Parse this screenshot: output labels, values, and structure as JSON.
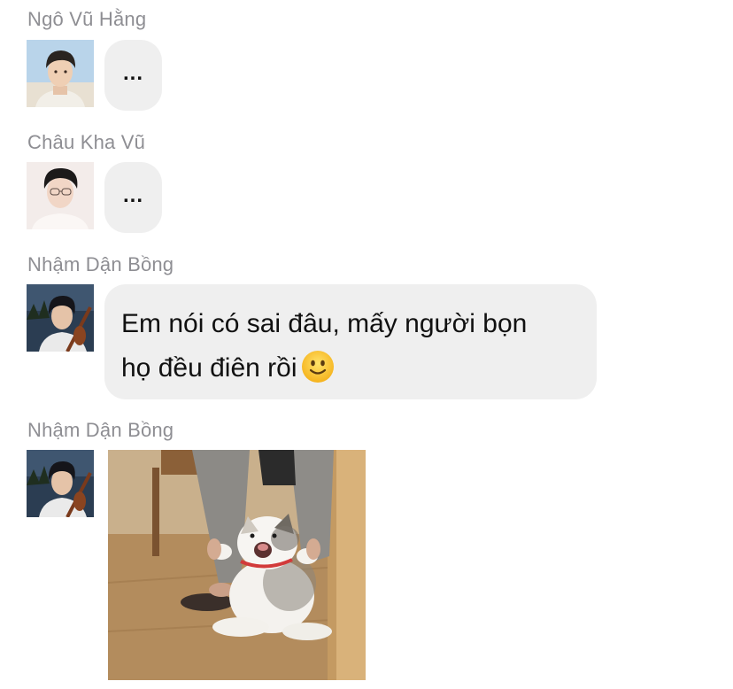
{
  "conversation": {
    "messages": [
      {
        "sender": "Ngô Vũ Hằng",
        "type": "typing",
        "text": "..."
      },
      {
        "sender": "Châu Kha Vũ",
        "type": "typing",
        "text": "..."
      },
      {
        "sender": "Nhậm Dận Bồng",
        "type": "text",
        "line1": "Em nói có sai đâu, mấy người bọn",
        "line2": "họ đều điên rồi",
        "emoji": "slightly-smiling-face-icon"
      },
      {
        "sender": "Nhậm Dận Bồng",
        "type": "image",
        "image": "screaming-cat-photo"
      }
    ]
  },
  "colors": {
    "bubble": "#efefef",
    "sender_name": "#8e8e93",
    "text": "#111111",
    "background": "#ffffff"
  }
}
